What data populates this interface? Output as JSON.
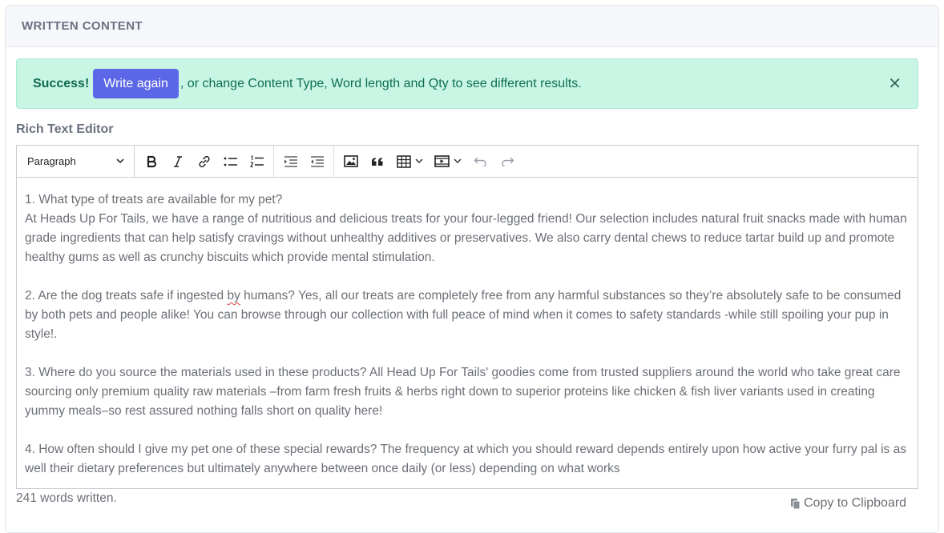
{
  "card": {
    "title": "WRITTEN CONTENT"
  },
  "alert": {
    "strong": "Success!",
    "button_label": "Write again",
    "message": ", or change Content Type, Word length and Qty to see different results.",
    "close_glyph": "✕"
  },
  "editor": {
    "label": "Rich Text Editor",
    "block_format": "Paragraph",
    "toolbar_icons": [
      "bold-icon",
      "italic-icon",
      "link-icon",
      "bulleted-list-icon",
      "numbered-list-icon",
      "outdent-icon",
      "indent-icon",
      "image-icon",
      "blockquote-icon",
      "table-icon",
      "media-icon",
      "undo-icon",
      "redo-icon"
    ],
    "paragraphs": [
      {
        "line1": "1. What type of treats are available for my pet?",
        "line2": "At Heads Up For Tails, we have a range of nutritious and delicious treats for your four-legged friend! Our selection includes natural fruit snacks made with human grade ingredients that can help satisfy cravings without unhealthy additives or preservatives. We also carry dental chews to reduce tartar build up and promote healthy gums as well as crunchy biscuits which provide mental stimulation."
      },
      {
        "before": "2. Are the dog treats safe if ingested ",
        "misspelled": "by",
        "after": " humans? Yes, all our treats are completely free from any harmful substances so they’re absolutely safe to be consumed by both pets and people alike! You can browse through our collection with full peace of mind when it comes to safety standards -while still spoiling your pup in style!."
      },
      {
        "text": "3. Where do you source the materials used in these products? All Head Up For Tails' goodies come from trusted suppliers around the world who take great care sourcing only premium quality raw materials –from farm fresh fruits & herbs right down to superior proteins like chicken & fish liver variants used in creating yummy meals–so rest assured nothing falls short on quality here!"
      },
      {
        "text": "4. How often should I give my pet one of these special rewards? The frequency at which you should reward depends entirely upon how active your furry pal is as well their dietary preferences but ultimately anywhere between once daily (or less) depending on what works"
      }
    ]
  },
  "footer": {
    "word_count": "241 words written.",
    "copy_label": "Copy to Clipboard"
  },
  "colors": {
    "accent_button": "#5b67e6",
    "alert_bg": "#c9f5e4",
    "alert_text": "#0d6f52"
  }
}
